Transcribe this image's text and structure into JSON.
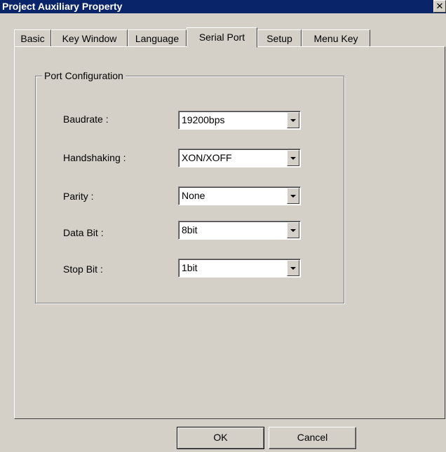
{
  "window": {
    "title": "Project Auxiliary Property",
    "close_label": "✕"
  },
  "tabs": [
    {
      "label": "Basic"
    },
    {
      "label": "Key Window"
    },
    {
      "label": "Language"
    },
    {
      "label": "Serial Port",
      "active": true
    },
    {
      "label": "Setup"
    },
    {
      "label": "Menu Key"
    }
  ],
  "port_config": {
    "group_title": "Port Configuration",
    "fields": [
      {
        "label": "Baudrate :",
        "value": "19200bps"
      },
      {
        "label": "Handshaking :",
        "value": "XON/XOFF"
      },
      {
        "label": "Parity :",
        "value": "None"
      },
      {
        "label": "Data Bit :",
        "value": "8bit"
      },
      {
        "label": "Stop Bit :",
        "value": "1bit"
      }
    ]
  },
  "buttons": {
    "ok_label": "OK",
    "cancel_label": "Cancel"
  },
  "colors": {
    "titlebar": "#0a246a",
    "face": "#d4d0c8"
  }
}
